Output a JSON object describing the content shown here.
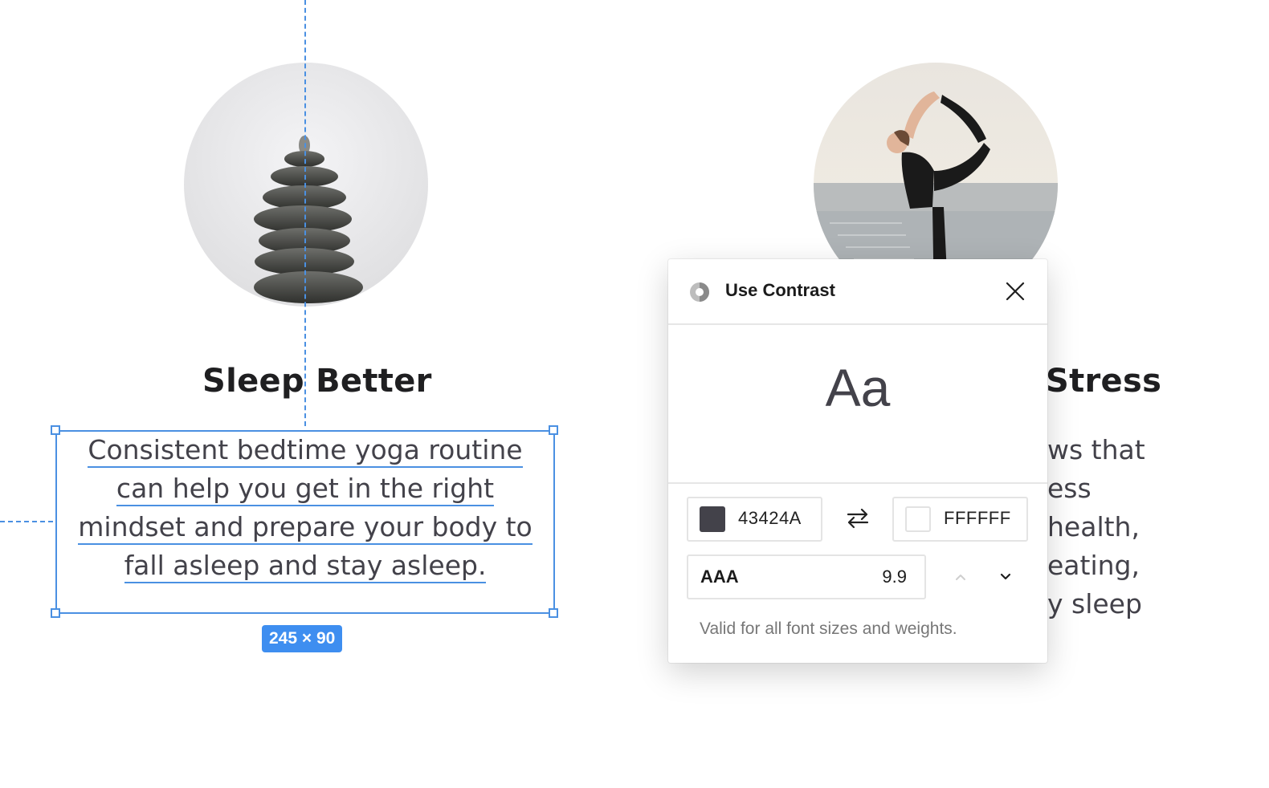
{
  "canvas": {
    "left_card": {
      "title": "Sleep Better",
      "body_lines": [
        "Consistent bedtime yoga routine",
        "can help you get in the right",
        "mindset and prepare your body to",
        "fall asleep and stay asleep."
      ],
      "image_alt": "stacked stones"
    },
    "right_card": {
      "title_fragment": "Stress",
      "body_fragments": [
        "ws that",
        "ess",
        "health,",
        "eating,",
        "y sleep"
      ],
      "image_alt": "woman doing yoga pose"
    },
    "selection": {
      "dimensions_label": "245 × 90",
      "color": "#4a90e2"
    }
  },
  "plugin": {
    "title": "Use Contrast",
    "logo_icon": "contrast-logo-icon",
    "close_icon": "close-icon",
    "preview_text": "Aa",
    "foreground": {
      "hex": "43424A",
      "color": "#43424A"
    },
    "swap_icon": "swap-arrows-icon",
    "background": {
      "hex": "FFFFFF",
      "color": "#FFFFFF"
    },
    "level": "AAA",
    "ratio": "9.9",
    "up_icon": "chevron-up-icon",
    "down_icon": "chevron-down-icon",
    "valid_message": "Valid for all font sizes and weights."
  }
}
